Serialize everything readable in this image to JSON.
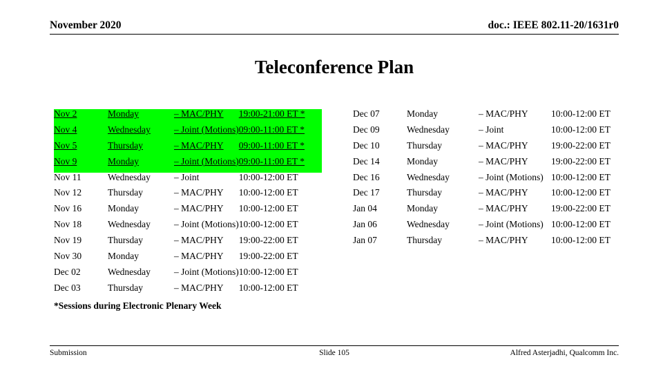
{
  "header": {
    "left": "November 2020",
    "right": "doc.: IEEE 802.11-20/1631r0"
  },
  "title": "Teleconference Plan",
  "footnote": "*Sessions during Electronic Plenary Week",
  "colors": {
    "highlight": "#00ff00",
    "text": "#000000",
    "background": "#ffffff"
  },
  "left_table": {
    "rows": [
      {
        "date": "Nov 2",
        "day": "Monday",
        "type": "– MAC/PHY",
        "time": "19:00-21:00 ET *",
        "highlight": true
      },
      {
        "date": "Nov 4",
        "day": "Wednesday",
        "type": "– Joint (Motions)",
        "time": "09:00-11:00 ET *",
        "highlight": true
      },
      {
        "date": "Nov 5",
        "day": "Thursday",
        "type": "– MAC/PHY",
        "time": "09:00-11:00 ET *",
        "highlight": true
      },
      {
        "date": "Nov 9",
        "day": "Monday",
        "type": "– Joint (Motions)",
        "time": "09:00-11:00 ET *",
        "highlight": true
      },
      {
        "date": "Nov 11",
        "day": "Wednesday",
        "type": "– Joint",
        "time": "10:00-12:00 ET",
        "highlight": false
      },
      {
        "date": "Nov 12",
        "day": "Thursday",
        "type": "– MAC/PHY",
        "time": "10:00-12:00 ET",
        "highlight": false
      },
      {
        "date": "Nov 16",
        "day": "Monday",
        "type": "– MAC/PHY",
        "time": "10:00-12:00 ET",
        "highlight": false
      },
      {
        "date": "Nov 18",
        "day": "Wednesday",
        "type": "– Joint (Motions)",
        "time": "10:00-12:00 ET",
        "highlight": false
      },
      {
        "date": "Nov 19",
        "day": "Thursday",
        "type": "– MAC/PHY",
        "time": "19:00-22:00 ET",
        "highlight": false
      },
      {
        "date": "Nov 30",
        "day": "Monday",
        "type": "– MAC/PHY",
        "time": "19:00-22:00 ET",
        "highlight": false
      },
      {
        "date": "Dec 02",
        "day": "Wednesday",
        "type": "– Joint (Motions)",
        "time": "10:00-12:00 ET",
        "highlight": false
      },
      {
        "date": "Dec 03",
        "day": "Thursday",
        "type": "– MAC/PHY",
        "time": "10:00-12:00 ET",
        "highlight": false
      }
    ]
  },
  "right_table": {
    "rows": [
      {
        "date": "Dec 07",
        "day": "Monday",
        "type": "– MAC/PHY",
        "time": "10:00-12:00 ET",
        "highlight": false
      },
      {
        "date": "Dec 09",
        "day": "Wednesday",
        "type": "– Joint",
        "time": "10:00-12:00 ET",
        "highlight": false
      },
      {
        "date": "Dec 10",
        "day": "Thursday",
        "type": "– MAC/PHY",
        "time": "19:00-22:00 ET",
        "highlight": false
      },
      {
        "date": "Dec 14",
        "day": "Monday",
        "type": "– MAC/PHY",
        "time": "19:00-22:00 ET",
        "highlight": false
      },
      {
        "date": "Dec 16",
        "day": "Wednesday",
        "type": "– Joint (Motions)",
        "time": "10:00-12:00 ET",
        "highlight": false
      },
      {
        "date": "Dec 17",
        "day": "Thursday",
        "type": "– MAC/PHY",
        "time": "10:00-12:00 ET",
        "highlight": false
      },
      {
        "date": "Jan 04",
        "day": "Monday",
        "type": "– MAC/PHY",
        "time": "19:00-22:00 ET",
        "highlight": false
      },
      {
        "date": "Jan 06",
        "day": "Wednesday",
        "type": "– Joint (Motions)",
        "time": "10:00-12:00 ET",
        "highlight": false
      },
      {
        "date": "Jan 07",
        "day": "Thursday",
        "type": "– MAC/PHY",
        "time": "10:00-12:00 ET",
        "highlight": false
      }
    ]
  },
  "footer": {
    "left": "Submission",
    "center": "Slide 105",
    "right": "Alfred Asterjadhi, Qualcomm Inc."
  }
}
